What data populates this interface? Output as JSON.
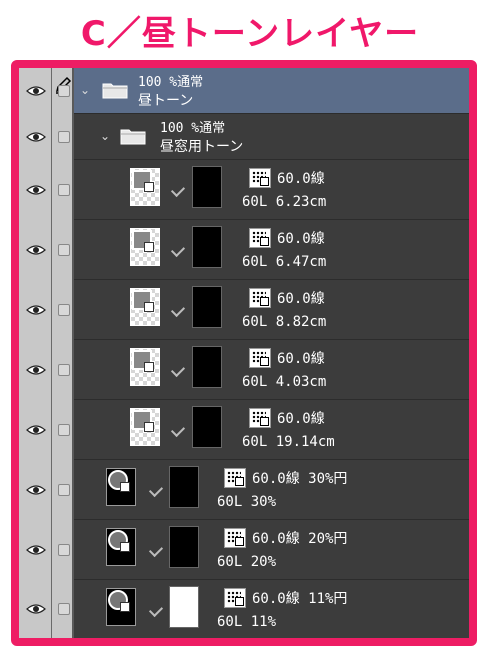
{
  "title": "C／昼トーンレイヤー",
  "colors": {
    "accent": "#ee1d64",
    "panel": "#3c3c3c",
    "selected": "#5b6d8a"
  },
  "folders": [
    {
      "line1": "100 %通常",
      "line2": "昼トーン"
    },
    {
      "line1": "100 %通常",
      "line2": "昼窓用トーン"
    }
  ],
  "layers": [
    {
      "line1": "60.0線",
      "line2": "60L 6.23cm"
    },
    {
      "line1": "60.0線",
      "line2": "60L 6.47cm"
    },
    {
      "line1": "60.0線",
      "line2": "60L 8.82cm"
    },
    {
      "line1": "60.0線",
      "line2": "60L 4.03cm"
    },
    {
      "line1": "60.0線",
      "line2": "60L 19.14cm"
    },
    {
      "line1": "60.0線 30%円",
      "line2": "60L 30%"
    },
    {
      "line1": "60.0線 20%円",
      "line2": "60L 20%"
    },
    {
      "line1": "60.0線 11%円",
      "line2": "60L 11%"
    }
  ]
}
